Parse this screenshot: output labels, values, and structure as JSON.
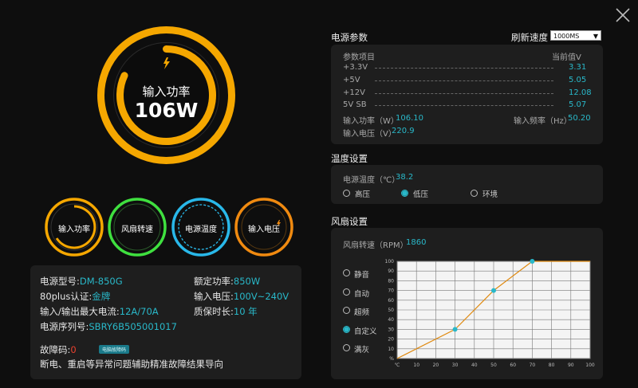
{
  "window": {
    "close_label": "×"
  },
  "main_gauge": {
    "title": "输入功率",
    "value": "106W",
    "fill": 0.82,
    "color": "#f5a700"
  },
  "small_gauges": [
    {
      "label": "输入功率",
      "color": "#f5a700"
    },
    {
      "label": "风扇转速",
      "color": "#3fe03f"
    },
    {
      "label": "电源温度",
      "color": "#29b8e9"
    },
    {
      "label": "输入电压",
      "color": "#f08a10"
    }
  ],
  "psu_info": {
    "model_label": "电源型号:",
    "model": "DM-850G",
    "rated_label": "额定功率:",
    "rated": "850W",
    "cert_label": "80plus认证:",
    "cert": "金牌",
    "voltage_label": "输入电压:",
    "voltage": "100V~240V",
    "current_label": "输入/输出最大电流:",
    "current": "12A/70A",
    "warranty_label": "质保时长:",
    "warranty": "10 年",
    "serial_label": "电源序列号:",
    "serial": "SBRY6B505001017",
    "fault_label": "故障码:",
    "fault_code": "0",
    "fault_badge": "电脑故障码",
    "fault_desc": "断电、重启等异常问题辅助精准故障结果导向"
  },
  "power_params": {
    "title": "电源参数",
    "refresh_label": "刷新速度",
    "refresh_value": "1000MS",
    "header_item": "参数项目",
    "header_value": "当前值V",
    "rows": [
      {
        "name": "+3.3V",
        "value": "3.31"
      },
      {
        "name": "+5V",
        "value": "5.05"
      },
      {
        "name": "+12V",
        "value": "12.08"
      },
      {
        "name": "5V SB",
        "value": "5.07"
      }
    ],
    "input_power_label": "输入功率（W）",
    "input_power": "106.10",
    "input_freq_label": "输入频率（Hz）",
    "input_freq": "50.20",
    "input_volt_label": "输入电压（V）",
    "input_volt": "220.9"
  },
  "temp_settings": {
    "title": "温度设置",
    "temp_label": "电源温度（℃）",
    "temp_value": "38.2",
    "options": [
      {
        "label": "高压",
        "selected": false
      },
      {
        "label": "低压",
        "selected": true
      },
      {
        "label": "环境",
        "selected": false
      }
    ]
  },
  "fan_settings": {
    "title": "风扇设置",
    "speed_label": "风扇转速（RPM）",
    "speed_value": "1860",
    "modes": [
      {
        "label": "静音",
        "selected": false
      },
      {
        "label": "自动",
        "selected": false
      },
      {
        "label": "超频",
        "selected": false
      },
      {
        "label": "自定义",
        "selected": true
      },
      {
        "label": "满灰",
        "selected": false
      }
    ]
  },
  "chart_data": {
    "type": "line",
    "x_ticks": [
      "℃",
      "10",
      "20",
      "30",
      "40",
      "50",
      "60",
      "70",
      "80",
      "90",
      "100"
    ],
    "y_ticks": [
      "%",
      "10",
      "20",
      "30",
      "40",
      "50",
      "60",
      "70",
      "80",
      "90",
      "100"
    ],
    "xlim": [
      0,
      100
    ],
    "ylim": [
      0,
      100
    ],
    "grid": true,
    "series": [
      {
        "x": [
          0,
          30,
          50,
          70,
          100
        ],
        "y": [
          0,
          30,
          70,
          100,
          100
        ]
      }
    ],
    "points": [
      {
        "x": 30,
        "y": 30
      },
      {
        "x": 50,
        "y": 70
      },
      {
        "x": 70,
        "y": 100
      }
    ],
    "line_color": "#e08a10",
    "point_color": "#29b8c9"
  }
}
